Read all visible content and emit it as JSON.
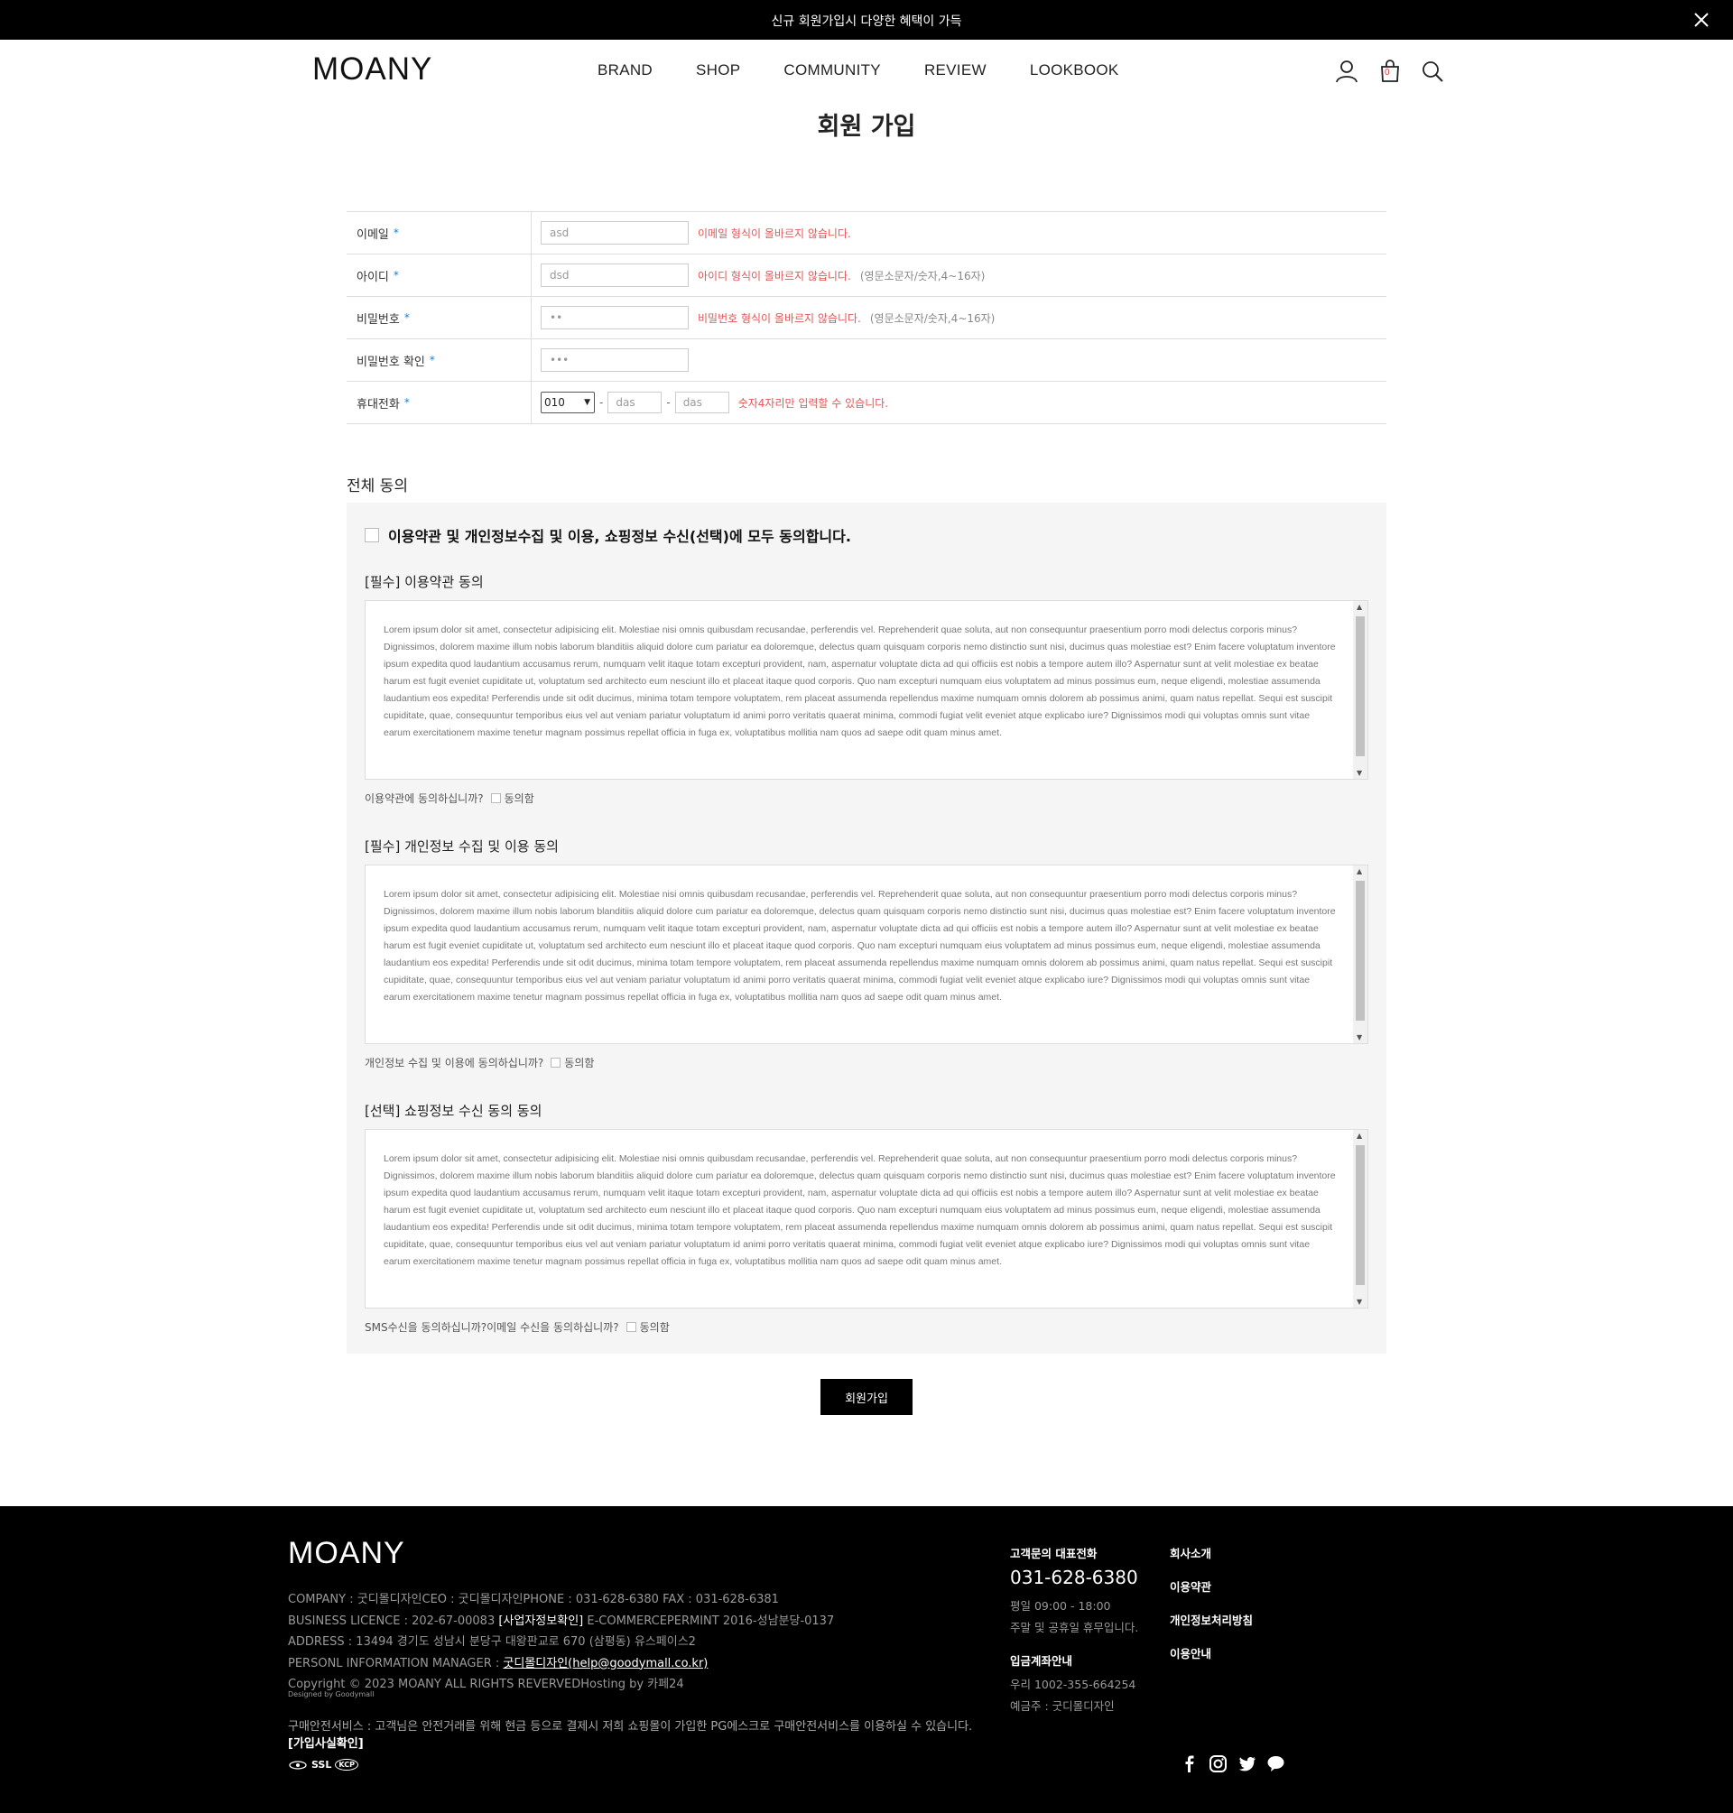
{
  "topbar": {
    "text": "신규 회원가입시 다양한 혜택이 가득"
  },
  "header": {
    "logo": "MOANY",
    "nav": [
      "BRAND",
      "SHOP",
      "COMMUNITY",
      "REVIEW",
      "LOOKBOOK"
    ],
    "cart_count": "0"
  },
  "page_title": "회원 가입",
  "form": {
    "email": {
      "label": "이메일",
      "value": "asd",
      "error": "이메일 형식이 올바르지 않습니다."
    },
    "userid": {
      "label": "아이디",
      "value": "dsd",
      "error": "아이디 형식이 올바르지 않습니다.",
      "hint": "(영문소문자/숫자,4~16자)"
    },
    "password": {
      "label": "비밀번호",
      "value": "••",
      "error": "비밀번호 형식이 올바르지 않습니다.",
      "hint": "(영문소문자/숫자,4~16자)"
    },
    "password_confirm": {
      "label": "비밀번호 확인",
      "value": "•••"
    },
    "phone": {
      "label": "휴대전화",
      "prefix": "010",
      "mid": "das",
      "last": "das",
      "error": "숫자4자리만 입력할 수 있습니다."
    },
    "required_mark": "*"
  },
  "agreement": {
    "title": "전체 동의",
    "all_agree": "이용약관 및 개인정보수집 및 이용, 쇼핑정보 수신(선택)에 모두 동의합니다.",
    "terms_text": "Lorem ipsum dolor sit amet, consectetur adipisicing elit. Molestiae nisi omnis quibusdam recusandae, perferendis vel. Reprehenderit quae soluta, aut non consequuntur praesentium porro modi delectus corporis minus? Dignissimos, dolorem maxime illum nobis laborum blanditiis aliquid dolore cum pariatur ea doloremque, delectus quam quisquam corporis nemo distinctio sunt nisi, ducimus quas molestiae est? Enim facere voluptatum inventore ipsum expedita quod laudantium accusamus rerum, numquam velit itaque totam excepturi provident, nam, aspernatur voluptate dicta ad qui officiis est nobis a tempore autem illo? Aspernatur sunt at velit molestiae ex beatae harum est fugit eveniet cupiditate ut, voluptatum sed architecto eum nesciunt illo et placeat itaque quod corporis. Quo nam excepturi numquam eius voluptatem ad minus possimus eum, neque eligendi, molestiae assumenda laudantium eos expedita! Perferendis unde sit odit ducimus, minima totam tempore voluptatem, rem placeat assumenda repellendus maxime numquam omnis dolorem ab possimus animi, quam natus repellat. Sequi est suscipit cupiditate, quae, consequuntur temporibus eius vel aut veniam pariatur voluptatum id animi porro veritatis quaerat minima, commodi fugiat velit eveniet atque explicabo iure? Dignissimos modi qui voluptas omnis sunt vitae earum exercitationem maxime tenetur magnam possimus repellat officia in fuga ex, voluptatibus mollitia nam quos ad saepe odit quam minus amet.",
    "sections": [
      {
        "title": "[필수] 이용약관 동의",
        "question": "이용약관에 동의하십니까?",
        "check_label": "동의함"
      },
      {
        "title": "[필수] 개인정보 수집 및 이용 동의",
        "question": "개인정보 수집 및 이용에 동의하십니까?",
        "check_label": "동의함"
      },
      {
        "title": "[선택] 쇼핑정보 수신 동의 동의",
        "question": "SMS수신을 동의하십니까?이메일 수신을 동의하십니까?",
        "check_label": "동의함"
      }
    ]
  },
  "submit_label": "회원가입",
  "footer": {
    "logo": "MOANY",
    "line1": "COMPANY : 굿디몰디자인CEO : 굿디몰디자인PHONE : 031-628-6380 FAX : 031-628-6381",
    "line2_a": "BUSINESS LICENCE : 202-67-00083 ",
    "line2_b": "[사업자정보확인]",
    "line2_c": " E-COMMERCEPERMINT 2016-성남분당-0137",
    "line3": "ADDRESS : 13494 경기도 성남시 분당구 대왕판교로 670 (삼평동) 유스페이스2",
    "line4_a": "PERSONL INFORMATION MANAGER : ",
    "line4_b": "굿디몰디자인(help@goodymall.co.kr)",
    "line5": "Copyright © 2023 MOANY ALL RIGHTS REVERVEDHosting by 카페24",
    "designed": "Designed by Goodymall",
    "escrow_a": "구매안전서비스 : 고객님은 안전거래를 위해 현금 등으로 결제시 저희 쇼핑몰이 가입한 PG에스크로 구매안전서비스를 이용하실 수 있습니다. ",
    "escrow_b": "[가입사실확인]",
    "ssl": "SSL",
    "ssl_sub": "KCP",
    "cs_title": "고객문의 대표전화",
    "cs_phone": "031-628-6380",
    "cs_hours": "평일 09:00 - 18:00",
    "cs_holiday": "주말 및 공휴일 휴무입니다.",
    "bank_title": "입금계좌안내",
    "bank_account": "우리 1002-355-664254",
    "bank_holder": "예금주 : 굿디몰디자인",
    "links": [
      "회사소개",
      "이용약관",
      "개인정보처리방침",
      "이용안내"
    ]
  },
  "colors": {
    "error": "#e45555",
    "required": "#1a7fc8",
    "footer_bg": "#000000",
    "topbar_bg": "#000000"
  },
  "icons": [
    "close-icon",
    "user-icon",
    "cart-icon",
    "search-icon",
    "facebook-icon",
    "instagram-icon",
    "twitter-icon",
    "kakaotalk-icon"
  ]
}
